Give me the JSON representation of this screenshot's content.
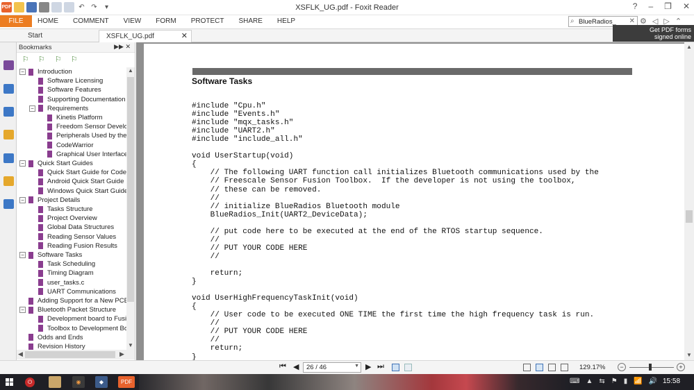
{
  "window": {
    "title": "XSFLK_UG.pdf - Foxit Reader",
    "controls": [
      "?",
      "–",
      "❐",
      "✕"
    ]
  },
  "quick_access": {
    "icons": [
      "pdf-logo-icon",
      "open-folder-icon",
      "save-icon",
      "print-icon",
      "new-doc-icon",
      "snapshot-icon",
      "undo-icon",
      "redo-icon",
      "customize-icon"
    ],
    "pdf_logo_text": "PDF"
  },
  "ribbon": {
    "file_label": "FILE",
    "tabs": [
      "HOME",
      "COMMENT",
      "VIEW",
      "FORM",
      "PROTECT",
      "SHARE",
      "HELP"
    ],
    "search_value": "BlueRadios_",
    "search_clear": "✕",
    "right_icons": [
      "⚙",
      "◁",
      "▷",
      "⌃"
    ]
  },
  "doc_tabs": {
    "start_label": "Start",
    "active_label": "XSFLK_UG.pdf",
    "close": "✕"
  },
  "promo": {
    "line1": "Get PDF forms",
    "line2": "signed online"
  },
  "bookmarks": {
    "title": "Bookmarks",
    "controls": "▶▶ ✕",
    "items": [
      {
        "label": "Introduction",
        "level": 0,
        "expander": "−"
      },
      {
        "label": "Software Licensing",
        "level": 1
      },
      {
        "label": "Software Features",
        "level": 1
      },
      {
        "label": "Supporting Documentation",
        "level": 1
      },
      {
        "label": "Requirements",
        "level": 1,
        "expander": "−"
      },
      {
        "label": "Kinetis Platform",
        "level": 2
      },
      {
        "label": "Freedom Sensor Develop",
        "level": 2
      },
      {
        "label": "Peripherals Used by the I",
        "level": 2
      },
      {
        "label": "CodeWarrior",
        "level": 2
      },
      {
        "label": "Graphical User Interface",
        "level": 2
      },
      {
        "label": "Quick Start Guides",
        "level": 0,
        "expander": "−"
      },
      {
        "label": "Quick Start Guide for CodeV",
        "level": 1
      },
      {
        "label": "Android Quick Start Guide",
        "level": 1
      },
      {
        "label": "Windows Quick Start Guide",
        "level": 1
      },
      {
        "label": "Project Details",
        "level": 0,
        "expander": "−"
      },
      {
        "label": "Tasks Structure",
        "level": 1
      },
      {
        "label": "Project Overview",
        "level": 1
      },
      {
        "label": "Global Data Structures",
        "level": 1
      },
      {
        "label": "Reading Sensor Values",
        "level": 1
      },
      {
        "label": "Reading Fusion Results",
        "level": 1
      },
      {
        "label": "Software Tasks",
        "level": 0,
        "expander": "−"
      },
      {
        "label": "Task Scheduling",
        "level": 1
      },
      {
        "label": "Timing Diagram",
        "level": 1
      },
      {
        "label": "user_tasks.c",
        "level": 1
      },
      {
        "label": "UART Communications",
        "level": 1
      },
      {
        "label": "Adding Support for a New PCB",
        "level": 0
      },
      {
        "label": "Bluetooth Packet Structure",
        "level": 0,
        "expander": "−"
      },
      {
        "label": "Development board to Fusio",
        "level": 1
      },
      {
        "label": "Toolbox to Development Bo",
        "level": 1
      },
      {
        "label": "Odds and Ends",
        "level": 0
      },
      {
        "label": "Revision History",
        "level": 0
      }
    ]
  },
  "document": {
    "heading": "Software Tasks",
    "code": [
      "#include \"Cpu.h\"",
      "#include \"Events.h\"",
      "#include \"mqx_tasks.h\"",
      "#include \"UART2.h\"",
      "#include \"include_all.h\"",
      "",
      "void UserStartup(void)",
      "{",
      "    // The following UART function call initializes Bluetooth communications used by the",
      "    // Freescale Sensor Fusion Toolbox.  If the developer is not using the toolbox,",
      "    // these can be removed.",
      "    //",
      "    // initialize BlueRadios Bluetooth module",
      "    BlueRadios_Init(UART2_DeviceData);",
      "",
      "    // put code here to be executed at the end of the RTOS startup sequence.",
      "    //",
      "    // PUT YOUR CODE HERE",
      "    //",
      "",
      "    return;",
      "}",
      "",
      "void UserHighFrequencyTaskInit(void)",
      "{",
      "    // User code to be executed ONE TIME the first time the high frequency task is run.",
      "    //",
      "    // PUT YOUR CODE HERE",
      "    //",
      "    return;",
      "}"
    ]
  },
  "statusbar": {
    "first": "⏮",
    "prev": "◀",
    "page_value": "26 / 46",
    "next": "▶",
    "last": "⏭",
    "zoom_value": "129.17%",
    "zoom_minus": "−",
    "zoom_plus": "+"
  },
  "taskbar": {
    "clock": "15:58",
    "foxit_label": "PDF",
    "tray_icons": [
      "⌨",
      "▲",
      "⇆",
      "⚑",
      "▮",
      "📶",
      "🔊"
    ]
  },
  "colors": {
    "file_tab": "#ec7d22",
    "bookmark_icon": "#8a3d8f",
    "doc_background": "#8f8f8f",
    "taskbar": "#1f1f25"
  }
}
